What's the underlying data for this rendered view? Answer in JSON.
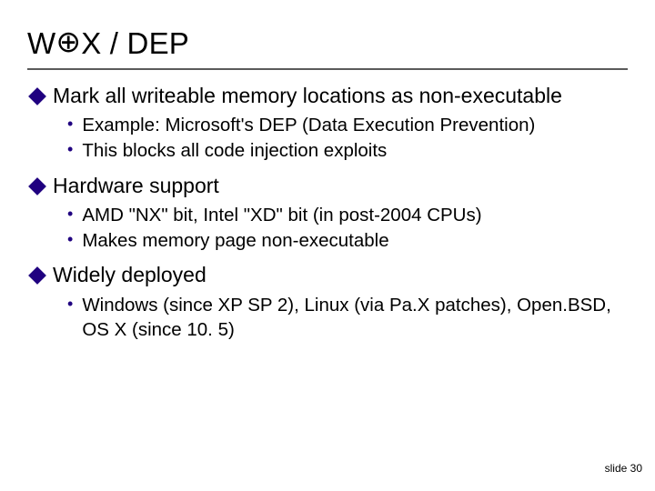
{
  "title_parts": {
    "pre": "W",
    "oplus": "⊕",
    "post": "X / DEP"
  },
  "sections": [
    {
      "heading": "Mark all writeable memory locations as non-executable",
      "subs": [
        "Example: Microsoft's DEP (Data Execution Prevention)",
        "This blocks all code injection exploits"
      ]
    },
    {
      "heading": "Hardware support",
      "subs": [
        "AMD \"NX\" bit, Intel \"XD\" bit (in post-2004 CPUs)",
        "Makes memory page non-executable"
      ]
    },
    {
      "heading": "Widely deployed",
      "subs": [
        "Windows (since XP SP 2), Linux (via Pa.X patches), Open.BSD, OS X (since 10. 5)"
      ]
    }
  ],
  "footer": "slide 30"
}
